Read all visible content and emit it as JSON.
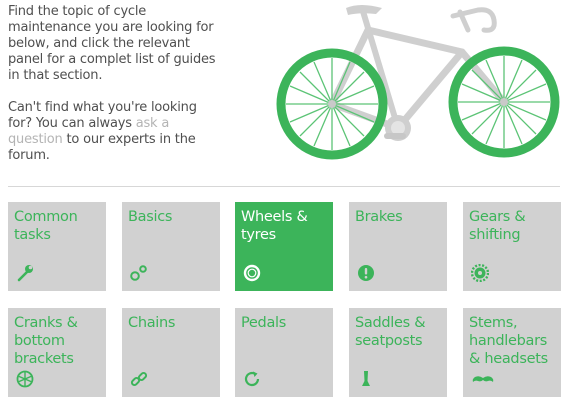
{
  "intro": {
    "paragraph1": "Find the topic of cycle maintenance you are looking for below, and click the relevant panel for a complet list of guides in that section.",
    "paragraph2_before": "Can't find what you're looking for? You can always ",
    "paragraph2_link": "ask a question",
    "paragraph2_after": " to our experts in the forum."
  },
  "colors": {
    "accent": "#3cb45a",
    "tile": "#d1d1d1",
    "bike_frame": "#cfcfcf",
    "text": "#4f4f4f",
    "link": "#b4b4b4"
  },
  "tiles": [
    {
      "label": "Common tasks",
      "icon": "wrench-icon",
      "active": false
    },
    {
      "label": "Basics",
      "icon": "bubbles-icon",
      "active": false
    },
    {
      "label": "Wheels & tyres",
      "icon": "tyre-icon",
      "active": true
    },
    {
      "label": "Brakes",
      "icon": "exclamation-circle-icon",
      "active": false
    },
    {
      "label": "Gears & shifting",
      "icon": "cog-icon",
      "active": false
    },
    {
      "label": "Cranks & bottom brackets",
      "icon": "chainring-icon",
      "active": false
    },
    {
      "label": "Chains",
      "icon": "chain-link-icon",
      "active": false
    },
    {
      "label": "Pedals",
      "icon": "refresh-arrow-icon",
      "active": false
    },
    {
      "label": "Saddles & seatposts",
      "icon": "saddle-icon",
      "active": false
    },
    {
      "label": "Stems, handlebars & headsets",
      "icon": "moustache-handlebar-icon",
      "active": false
    }
  ]
}
